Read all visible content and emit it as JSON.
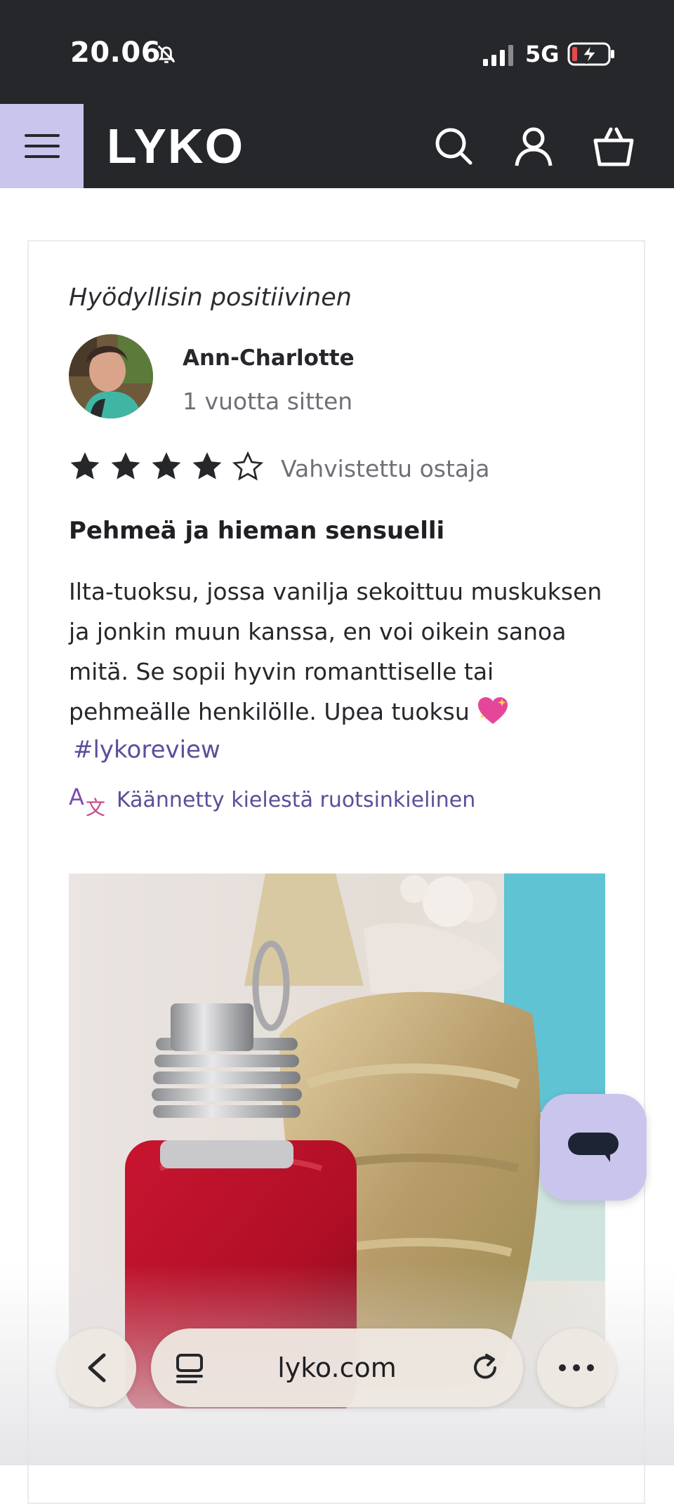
{
  "status_bar": {
    "time": "20.06",
    "network": "5G",
    "icons": [
      "bell-off-icon",
      "signal-icon",
      "battery-charging-icon"
    ]
  },
  "header": {
    "logo": "LYKO",
    "icons": [
      "menu-icon",
      "search-icon",
      "account-icon",
      "cart-icon"
    ],
    "accent_color": "#c9c5ec",
    "background_color": "#26272b"
  },
  "review": {
    "label": "Hyödyllisin positiivinen",
    "reviewer": {
      "name": "Ann-Charlotte",
      "time_ago": "1 vuotta sitten"
    },
    "rating": 4,
    "rating_max": 5,
    "verified": "Vahvistettu ostaja",
    "title": "Pehmeä ja hieman sensuelli",
    "body": "Ilta-tuoksu, jossa vanilja sekoittuu muskuksen ja jonkin muun kanssa, en voi oikein sanoa mitä. Se sopii hyvin romanttiselle tai pehmeälle henkilölle. Upea tuoksu",
    "hashtag": "#lykoreview",
    "translated_note": "Käännetty kielestä ruotsinkielinen",
    "link_color": "#5a4f9a"
  },
  "chat": {
    "icon": "chat-bubble-icon"
  },
  "browser": {
    "url": "lyko.com",
    "icons": [
      "back-icon",
      "tabs-icon",
      "reload-icon",
      "more-icon"
    ]
  }
}
